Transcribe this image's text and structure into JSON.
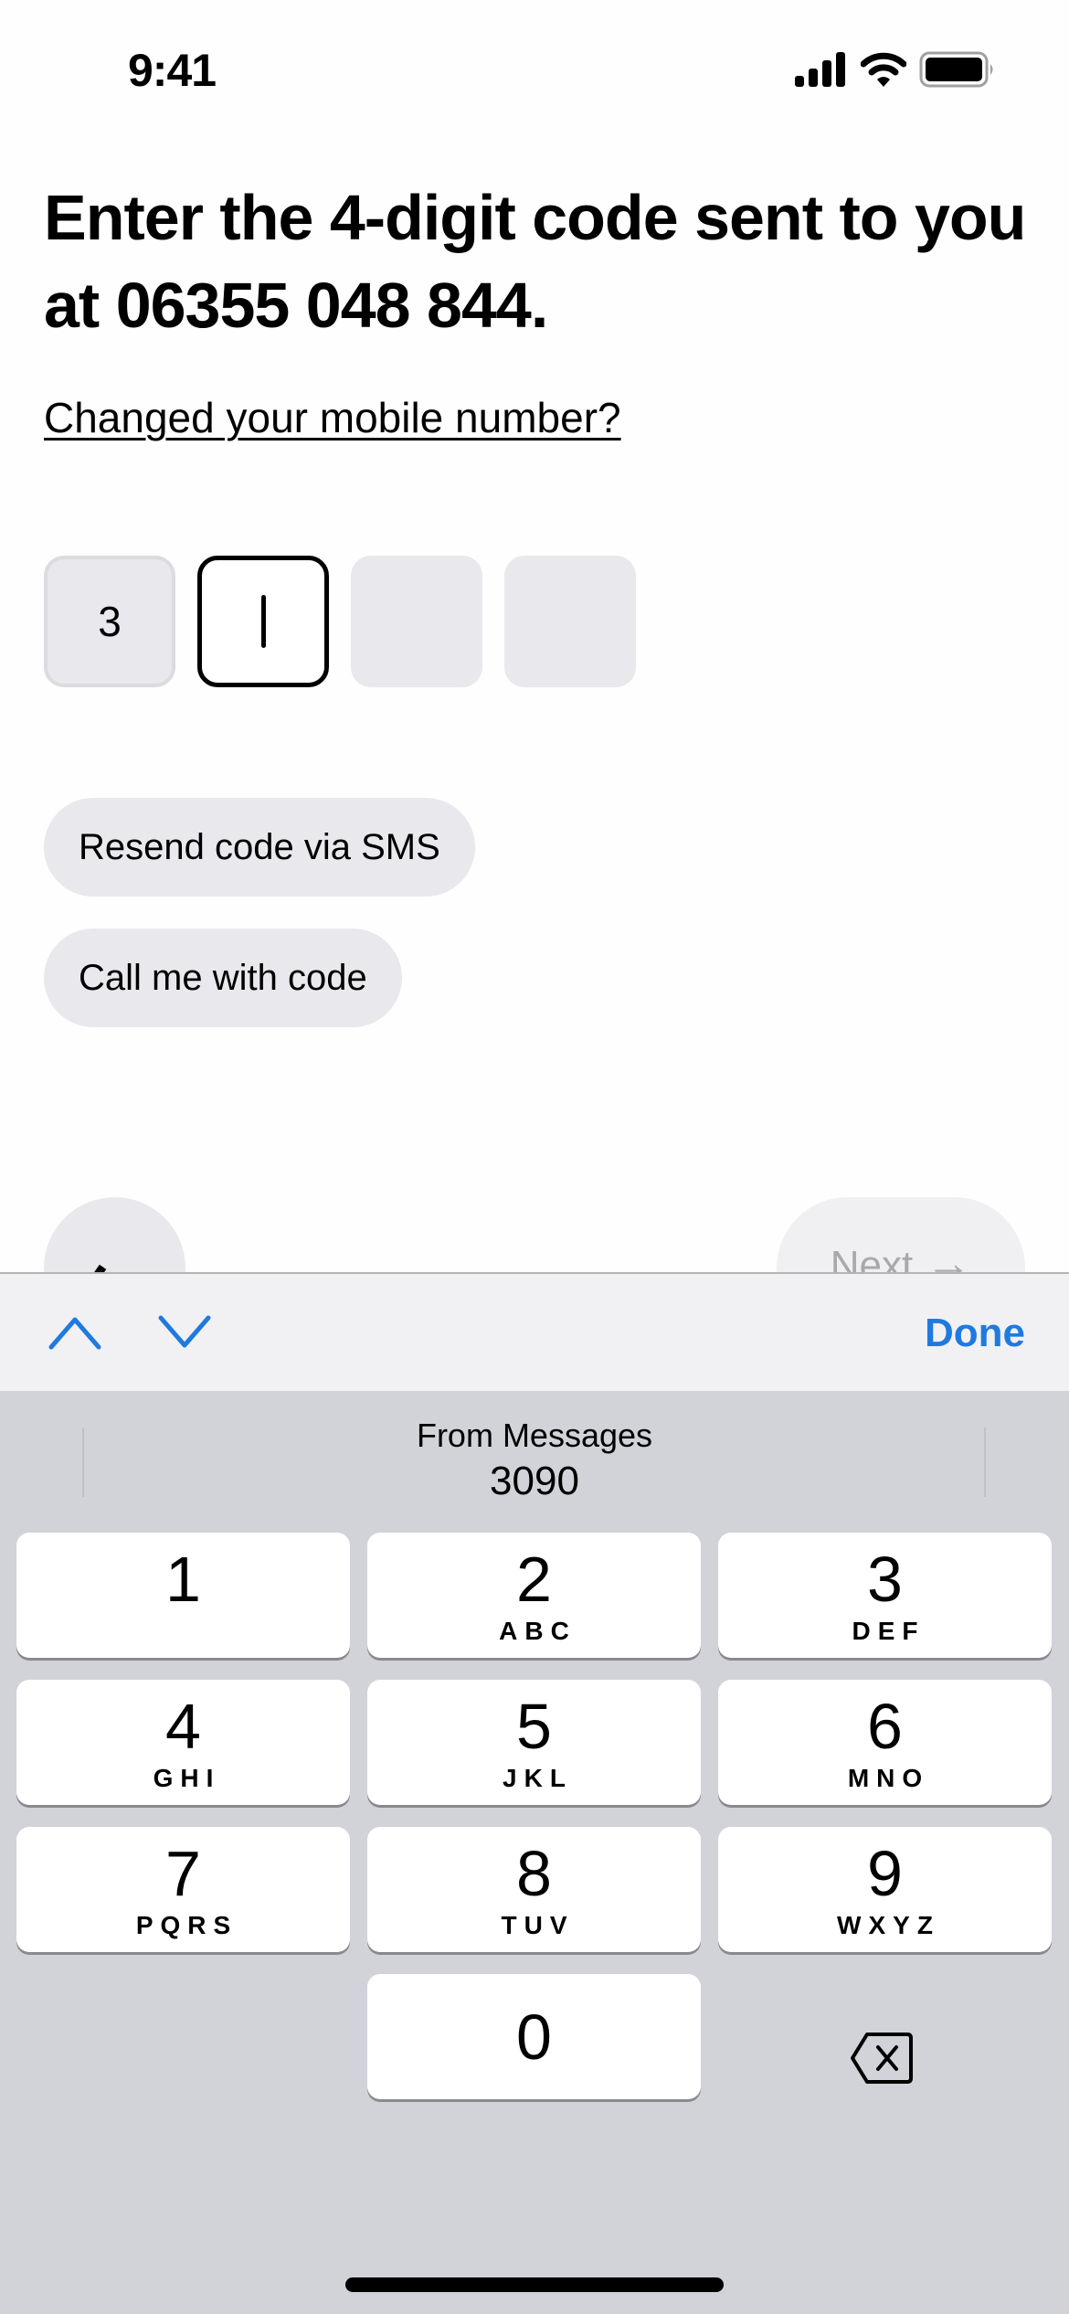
{
  "status_bar": {
    "time": "9:41",
    "icons": [
      "cellular-signal-icon",
      "wifi-icon",
      "battery-icon"
    ]
  },
  "verification": {
    "heading": "Enter the 4-digit code sent to you at 06355 048 844.",
    "change_number_link": "Changed your mobile number?",
    "code_digits": [
      "3",
      "",
      "",
      ""
    ],
    "active_index": 1,
    "resend_sms_label": "Resend code via SMS",
    "call_me_label": "Call me with code",
    "back_icon": "arrow-left-icon",
    "next_label": "Next",
    "next_icon": "arrow-right-icon"
  },
  "accessory_bar": {
    "prev_icon": "chevron-up-icon",
    "next_icon": "chevron-down-icon",
    "done_label": "Done"
  },
  "keyboard": {
    "suggestion_title": "From Messages",
    "suggestion_code": "3090",
    "keys": [
      {
        "num": "1",
        "letters": ""
      },
      {
        "num": "2",
        "letters": "ABC"
      },
      {
        "num": "3",
        "letters": "DEF"
      },
      {
        "num": "4",
        "letters": "GHI"
      },
      {
        "num": "5",
        "letters": "JKL"
      },
      {
        "num": "6",
        "letters": "MNO"
      },
      {
        "num": "7",
        "letters": "PQRS"
      },
      {
        "num": "8",
        "letters": "TUV"
      },
      {
        "num": "9",
        "letters": "WXYZ"
      },
      {
        "num": "0",
        "letters": ""
      }
    ],
    "delete_icon": "backspace-icon"
  },
  "colors": {
    "accent": "#1f7ae0",
    "pill_bg": "#e9e8ec",
    "keyboard_bg": "#d1d3d9"
  }
}
